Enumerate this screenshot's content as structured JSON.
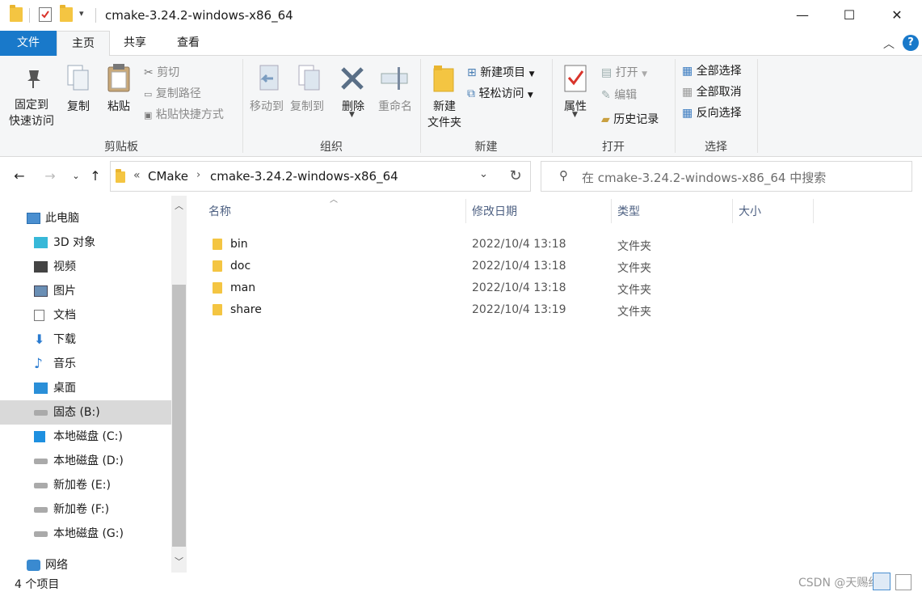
{
  "window": {
    "title": "cmake-3.24.2-windows-x86_64",
    "minimize": "—",
    "maximize": "☐",
    "close": "✕"
  },
  "tabs": [
    "文件",
    "主页",
    "共享",
    "查看"
  ],
  "ribbon": {
    "clipboard": {
      "label": "剪贴板",
      "pin": [
        "固定到",
        "快速访问"
      ],
      "copy": "复制",
      "paste": "粘贴",
      "cut": "剪切",
      "copy_path": "复制路径",
      "paste_shortcut": "粘贴快捷方式"
    },
    "organize": {
      "label": "组织",
      "move_to": "移动到",
      "copy_to": "复制到",
      "delete": "删除",
      "rename": "重命名"
    },
    "new": {
      "label": "新建",
      "new_folder": [
        "新建",
        "文件夹"
      ],
      "new_item": "新建项目",
      "easy_access": "轻松访问"
    },
    "open": {
      "label": "打开",
      "properties": "属性",
      "open": "打开",
      "edit": "编辑",
      "history": "历史记录"
    },
    "select": {
      "label": "选择",
      "select_all": "全部选择",
      "select_none": "全部取消",
      "invert": "反向选择"
    }
  },
  "address": {
    "prefix": "«",
    "crumbs": [
      "CMake",
      "cmake-3.24.2-windows-x86_64"
    ],
    "search_placeholder": "在 cmake-3.24.2-windows-x86_64 中搜索"
  },
  "sidebar": {
    "items": [
      {
        "label": "此电脑",
        "icon": "pc-icon"
      },
      {
        "label": "3D 对象",
        "icon": "3d-objects-icon"
      },
      {
        "label": "视频",
        "icon": "video-icon"
      },
      {
        "label": "图片",
        "icon": "pictures-icon"
      },
      {
        "label": "文档",
        "icon": "documents-icon"
      },
      {
        "label": "下载",
        "icon": "download-icon"
      },
      {
        "label": "音乐",
        "icon": "music-icon"
      },
      {
        "label": "桌面",
        "icon": "desktop-icon"
      },
      {
        "label": "固态 (B:)",
        "icon": "drive-icon"
      },
      {
        "label": "本地磁盘 (C:)",
        "icon": "windows-drive-icon"
      },
      {
        "label": "本地磁盘 (D:)",
        "icon": "drive-icon"
      },
      {
        "label": "新加卷 (E:)",
        "icon": "drive-icon"
      },
      {
        "label": "新加卷 (F:)",
        "icon": "drive-icon"
      },
      {
        "label": "本地磁盘 (G:)",
        "icon": "drive-icon"
      },
      {
        "label": "网络",
        "icon": "network-icon"
      }
    ],
    "selected_index": 8
  },
  "columns": [
    "名称",
    "修改日期",
    "类型",
    "大小"
  ],
  "files": [
    {
      "name": "bin",
      "date": "2022/10/4 13:18",
      "type": "文件夹"
    },
    {
      "name": "doc",
      "date": "2022/10/4 13:18",
      "type": "文件夹"
    },
    {
      "name": "man",
      "date": "2022/10/4 13:18",
      "type": "文件夹"
    },
    {
      "name": "share",
      "date": "2022/10/4 13:19",
      "type": "文件夹"
    }
  ],
  "status": {
    "count": "4 个项目"
  },
  "watermark": "CSDN @天赐细莲",
  "colors": {
    "file_tab": "#1979ca",
    "folder": "#f4c542",
    "header_text": "#4d6082",
    "selection": "#d9d9d9"
  }
}
